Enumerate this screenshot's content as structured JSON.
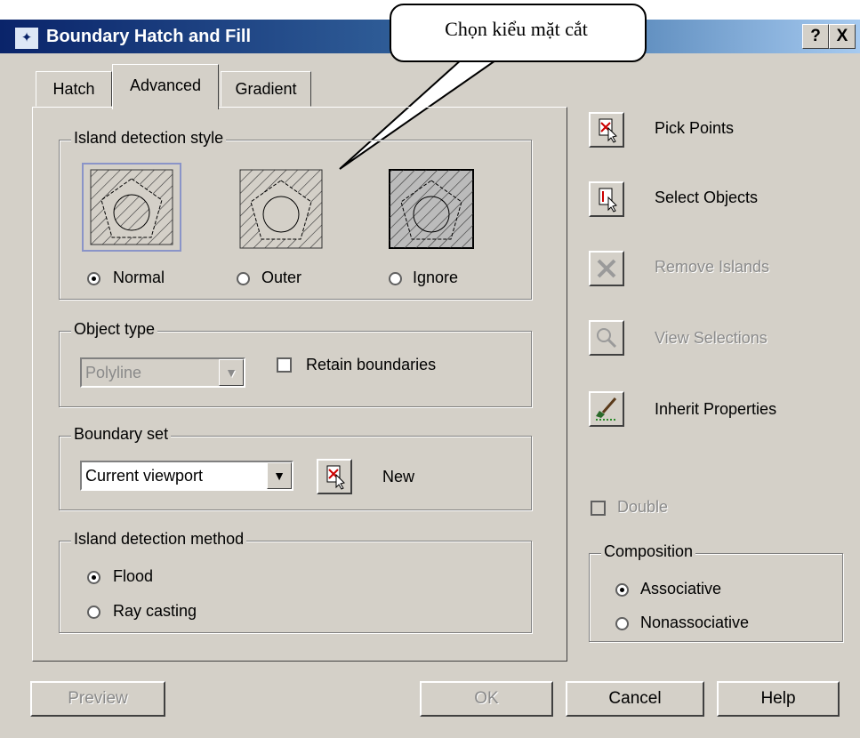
{
  "title": "Boundary Hatch and Fill",
  "titlebar_buttons": {
    "help": "?",
    "close": "X"
  },
  "callout": "Chọn kiểu mặt cắt",
  "tabs": [
    "Hatch",
    "Advanced",
    "Gradient"
  ],
  "island_style": {
    "label": "Island detection style",
    "options": [
      {
        "label": "Normal",
        "selected": true
      },
      {
        "label": "Outer",
        "selected": false
      },
      {
        "label": "Ignore",
        "selected": false
      }
    ]
  },
  "object_type": {
    "label": "Object type",
    "value": "Polyline",
    "retain_label": "Retain boundaries"
  },
  "boundary_set": {
    "label": "Boundary set",
    "value": "Current viewport",
    "new_label": "New"
  },
  "island_method": {
    "label": "Island detection method",
    "options": [
      {
        "label": "Flood",
        "selected": true
      },
      {
        "label": "Ray casting",
        "selected": false
      }
    ]
  },
  "right_actions": [
    {
      "label": "Pick Points",
      "enabled": true,
      "icon": "pick-points-icon"
    },
    {
      "label": "Select Objects",
      "enabled": true,
      "icon": "select-objects-icon"
    },
    {
      "label": "Remove Islands",
      "enabled": false,
      "icon": "remove-islands-icon"
    },
    {
      "label": "View Selections",
      "enabled": false,
      "icon": "magnifier-icon"
    },
    {
      "label": "Inherit Properties",
      "enabled": true,
      "icon": "brush-icon"
    }
  ],
  "double_label": "Double",
  "composition": {
    "label": "Composition",
    "options": [
      {
        "label": "Associative",
        "selected": true
      },
      {
        "label": "Nonassociative",
        "selected": false
      }
    ]
  },
  "buttons": {
    "preview": "Preview",
    "ok": "OK",
    "cancel": "Cancel",
    "help": "Help"
  },
  "colors": {
    "title_bar": "#0a246a",
    "dialog_face": "#d4d0c8",
    "disabled_text": "#8a8a8a"
  }
}
